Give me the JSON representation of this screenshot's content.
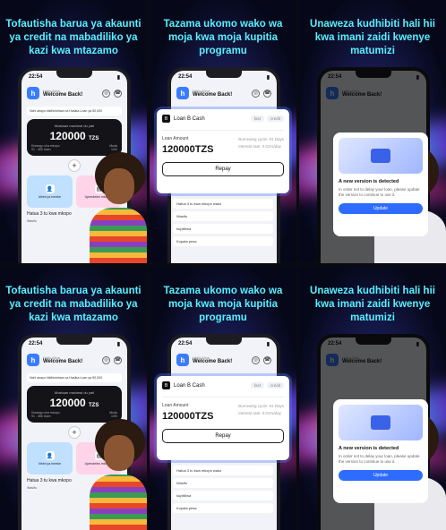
{
  "panels": [
    {
      "headline": "Tofautisha barua ya akaunti ya credit na mabadiliko ya kazi kwa mtazamo"
    },
    {
      "headline": "Tazama ukomo wako wa moja kwa moja kupitia programu"
    },
    {
      "headline": "Unaweza kudhibiti hali hii kwa imani zaidi kwenye matumizi"
    }
  ],
  "phone": {
    "time": "22:54",
    "hello": "Hello Alina",
    "welcome": "Welcome Back!",
    "notice": "Nchi anayo kiidhinishwa na Hasika Loan ya 50,000",
    "limit_label": "Mostaan maximal du yati",
    "amount": "120000",
    "currency": "TZS",
    "row1_left": "Kiwango cha mkopo",
    "row1_right": "Muda",
    "row2_left": "91 - 365 Ituen",
    "row2_right": "14%",
    "tile1": "Idhini ya hereke",
    "tile2": "Upendeleo mkubwa",
    "steps_title": "Hatua 3 tu kwa mkopo",
    "step1": "Wasifu"
  },
  "popup": {
    "brand": "Loan B Cash",
    "chip1": "fast",
    "chip2": "credit",
    "amount_label": "Loan Amount",
    "amount": "120000TZS",
    "cycle": "Borrowing cycle: 91 Days",
    "rate": "Interest rate: 0.01%/day",
    "button": "Repay"
  },
  "list": {
    "title": "Hatua 3 tu kwa mkopo wako",
    "r1": "Wasifu",
    "r2": "kupitiliwa",
    "r3": "Kupata pesa"
  },
  "update": {
    "title": "A new version is detected",
    "body": "In order not to delay your loan, please update the version to continue to use it.",
    "button": "Update"
  }
}
